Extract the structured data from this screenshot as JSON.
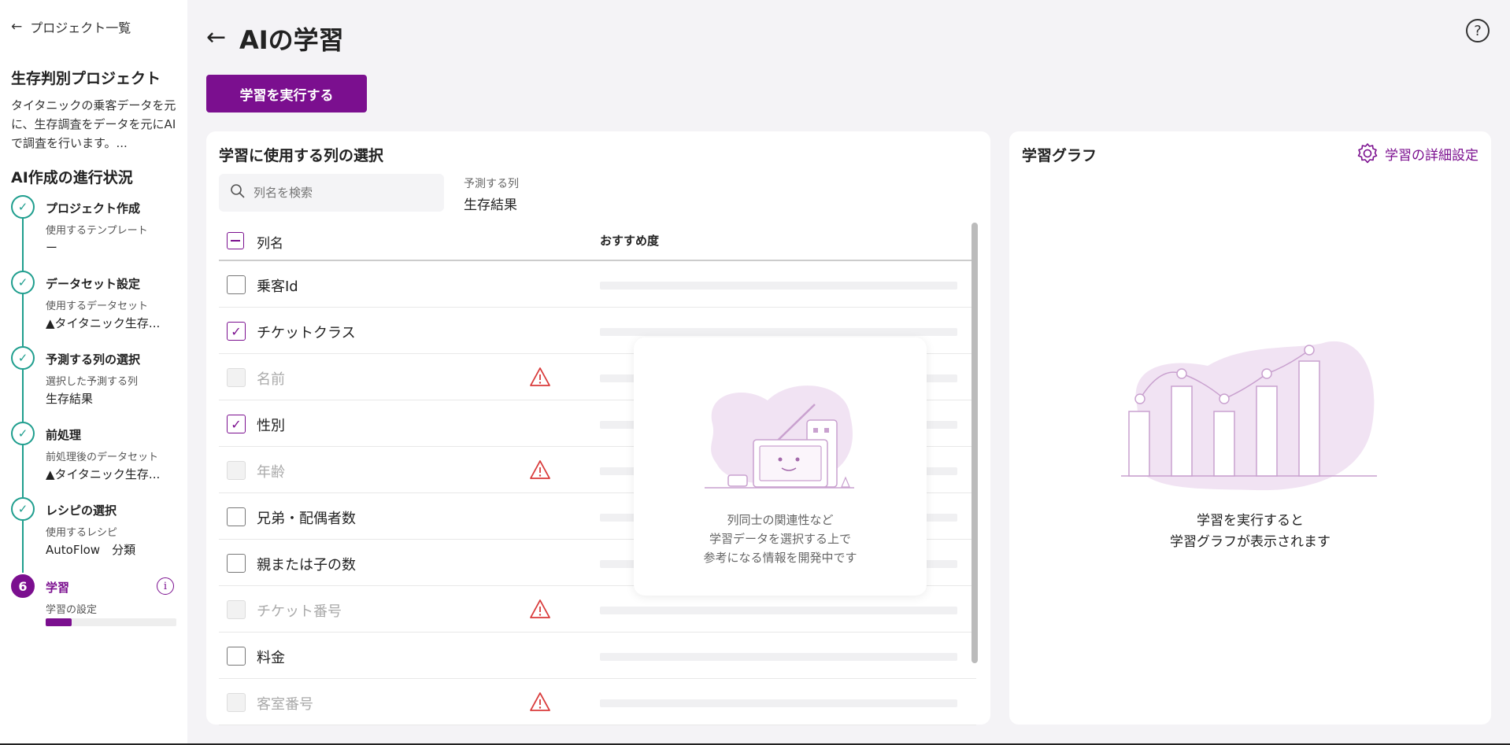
{
  "sidebar": {
    "back_label": "プロジェクト一覧",
    "project_title": "生存判別プロジェクト",
    "project_desc": "タイタニックの乗客データを元に、生存調査をデータを元にAIで調査を行います。...",
    "progress_title": "AI作成の進行状況",
    "steps": [
      {
        "title": "プロジェクト作成",
        "sub": "使用するテンプレート",
        "value": "ー",
        "status": "done"
      },
      {
        "title": "データセット設定",
        "sub": "使用するデータセット",
        "value": "▲タイタニック生存...",
        "status": "done"
      },
      {
        "title": "予測する列の選択",
        "sub": "選択した予測する列",
        "value": "生存結果",
        "status": "done"
      },
      {
        "title": "前処理",
        "sub": "前処理後のデータセット",
        "value": "▲タイタニック生存...",
        "status": "done"
      },
      {
        "title": "レシピの選択",
        "sub": "使用するレシピ",
        "value": "AutoFlow　分類",
        "status": "done"
      },
      {
        "title": "学習",
        "sub": "学習の設定",
        "number": "6",
        "status": "active",
        "progress": 0.2
      }
    ],
    "info_icon": "i"
  },
  "header": {
    "title": "AIの学習",
    "help_icon": "?"
  },
  "run_button": "学習を実行する",
  "column_card": {
    "title": "学習に使用する列の選択",
    "search_placeholder": "列名を検索",
    "target_label": "予測する列",
    "target_value": "生存結果",
    "col_header_name": "列名",
    "col_header_rec": "おすすめ度",
    "rows": [
      {
        "name": "乗客Id",
        "state": "unchecked",
        "warning": false
      },
      {
        "name": "チケットクラス",
        "state": "checked",
        "warning": false
      },
      {
        "name": "名前",
        "state": "disabled",
        "warning": true
      },
      {
        "name": "性別",
        "state": "checked",
        "warning": false
      },
      {
        "name": "年齢",
        "state": "disabled",
        "warning": true
      },
      {
        "name": "兄弟・配偶者数",
        "state": "unchecked",
        "warning": false
      },
      {
        "name": "親または子の数",
        "state": "unchecked",
        "warning": false
      },
      {
        "name": "チケット番号",
        "state": "disabled",
        "warning": true
      },
      {
        "name": "料金",
        "state": "unchecked",
        "warning": false
      },
      {
        "name": "客室番号",
        "state": "disabled",
        "warning": true
      }
    ],
    "overlay_lines": [
      "列同士の関連性など",
      "学習データを選択する上で",
      "参考になる情報を開発中です"
    ]
  },
  "graph_card": {
    "title": "学習グラフ",
    "settings_label": "学習の詳細設定",
    "message_lines": [
      "学習を実行すると",
      "学習グラフが表示されます"
    ]
  },
  "colors": {
    "accent": "#7b0f8f",
    "done": "#1f9e8e",
    "warning": "#d93a3a"
  }
}
